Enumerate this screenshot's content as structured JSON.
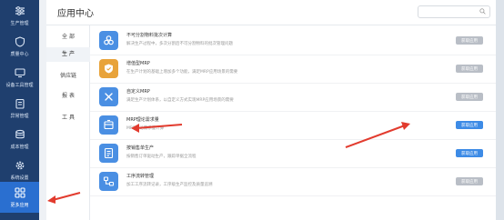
{
  "nav": {
    "items": [
      {
        "label": "生产管理"
      },
      {
        "label": "质量中心"
      },
      {
        "label": "设备工具管理"
      },
      {
        "label": "异常管理"
      },
      {
        "label": "成本管理"
      },
      {
        "label": "系统设置"
      },
      {
        "label": "更多应用"
      }
    ]
  },
  "panel": {
    "title": "应用中心"
  },
  "categories": [
    {
      "label": "全 部"
    },
    {
      "label": "生 产"
    },
    {
      "label": "供应链"
    },
    {
      "label": "报 表"
    },
    {
      "label": "工 具"
    }
  ],
  "apps": [
    {
      "name": "不可分割物料批次计算",
      "desc": "解决生产过程中，多次分割后不可分割物料的批次管理问题",
      "button": "获取应用",
      "icon": "link-icon"
    },
    {
      "name": "增值型MRP",
      "desc": "在生产计划的基础上增加多个功能，满足MRP应用场景的需要",
      "button": "获取应用",
      "icon": "shield-icon"
    },
    {
      "name": "自定义MRP",
      "desc": "满足生产计划体系，以自定义方式实现MRP应用场景的需要",
      "button": "获取应用",
      "icon": "tools-icon"
    },
    {
      "name": "MRP理论需求量",
      "desc": "MRP理论需求量计算",
      "button": "获取应用",
      "icon": "box-icon"
    },
    {
      "name": "按销售单生产",
      "desc": "按销售订单驱动生产，跟踪单据全流程",
      "button": "获取应用",
      "icon": "document-icon"
    },
    {
      "name": "工序流转管理",
      "desc": "加工工序流转记录，工序级生产监控及质量追溯",
      "button": "获取应用",
      "icon": "flow-icon"
    }
  ],
  "colors": {
    "nav_bg": "#1f3f6e",
    "nav_active": "#2a6fd0",
    "accent": "#3d8be6",
    "arrow": "#e23b2e"
  }
}
